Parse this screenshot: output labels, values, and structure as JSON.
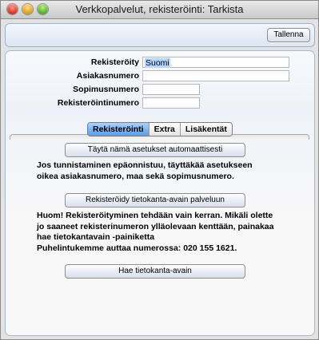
{
  "window": {
    "title": "Verkkopalvelut, rekisteröinti: Tarkista"
  },
  "toolbar": {
    "save_label": "Tallenna"
  },
  "form": {
    "registered_label": "Rekisteröity",
    "registered_value": "Suomi",
    "customer_number_label": "Asiakasnumero",
    "customer_number_value": "",
    "contract_number_label": "Sopimusnumero",
    "contract_number_value": "",
    "registration_number_label": "Rekisteröintinumero",
    "registration_number_value": ""
  },
  "tabs": [
    {
      "label": "Rekisteröinti",
      "active": true
    },
    {
      "label": "Extra",
      "active": false
    },
    {
      "label": "Lisäkentät",
      "active": false
    }
  ],
  "content": {
    "auto_fill_button": "Täytä nämä asetukset automaattisesti",
    "auto_fill_text_1": "Jos tunnistaminen epäonnistuu, täyttäkää asetukseen",
    "auto_fill_text_2": "oikea asiakasnumero, maa sekä sopimusnumero.",
    "register_key_button": "Rekisteröidy tietokanta-avain palveluun",
    "register_text_1": "Huom! Rekisteröityminen tehdään vain kerran. Mikäli olette",
    "register_text_2": "jo saaneet rekisterinumeron ylläolevaan kenttään, painakaa",
    "register_text_3": "hae tietokantavain -painiketta",
    "register_text_4": "Puhelintukemme auttaa numerossa: 020 155 1621.",
    "fetch_key_button": "Hae tietokanta-avain"
  },
  "colors": {
    "active_tab": "#5b9be5",
    "selection": "#b5d5ff",
    "panel_border": "#a5b6cf"
  }
}
